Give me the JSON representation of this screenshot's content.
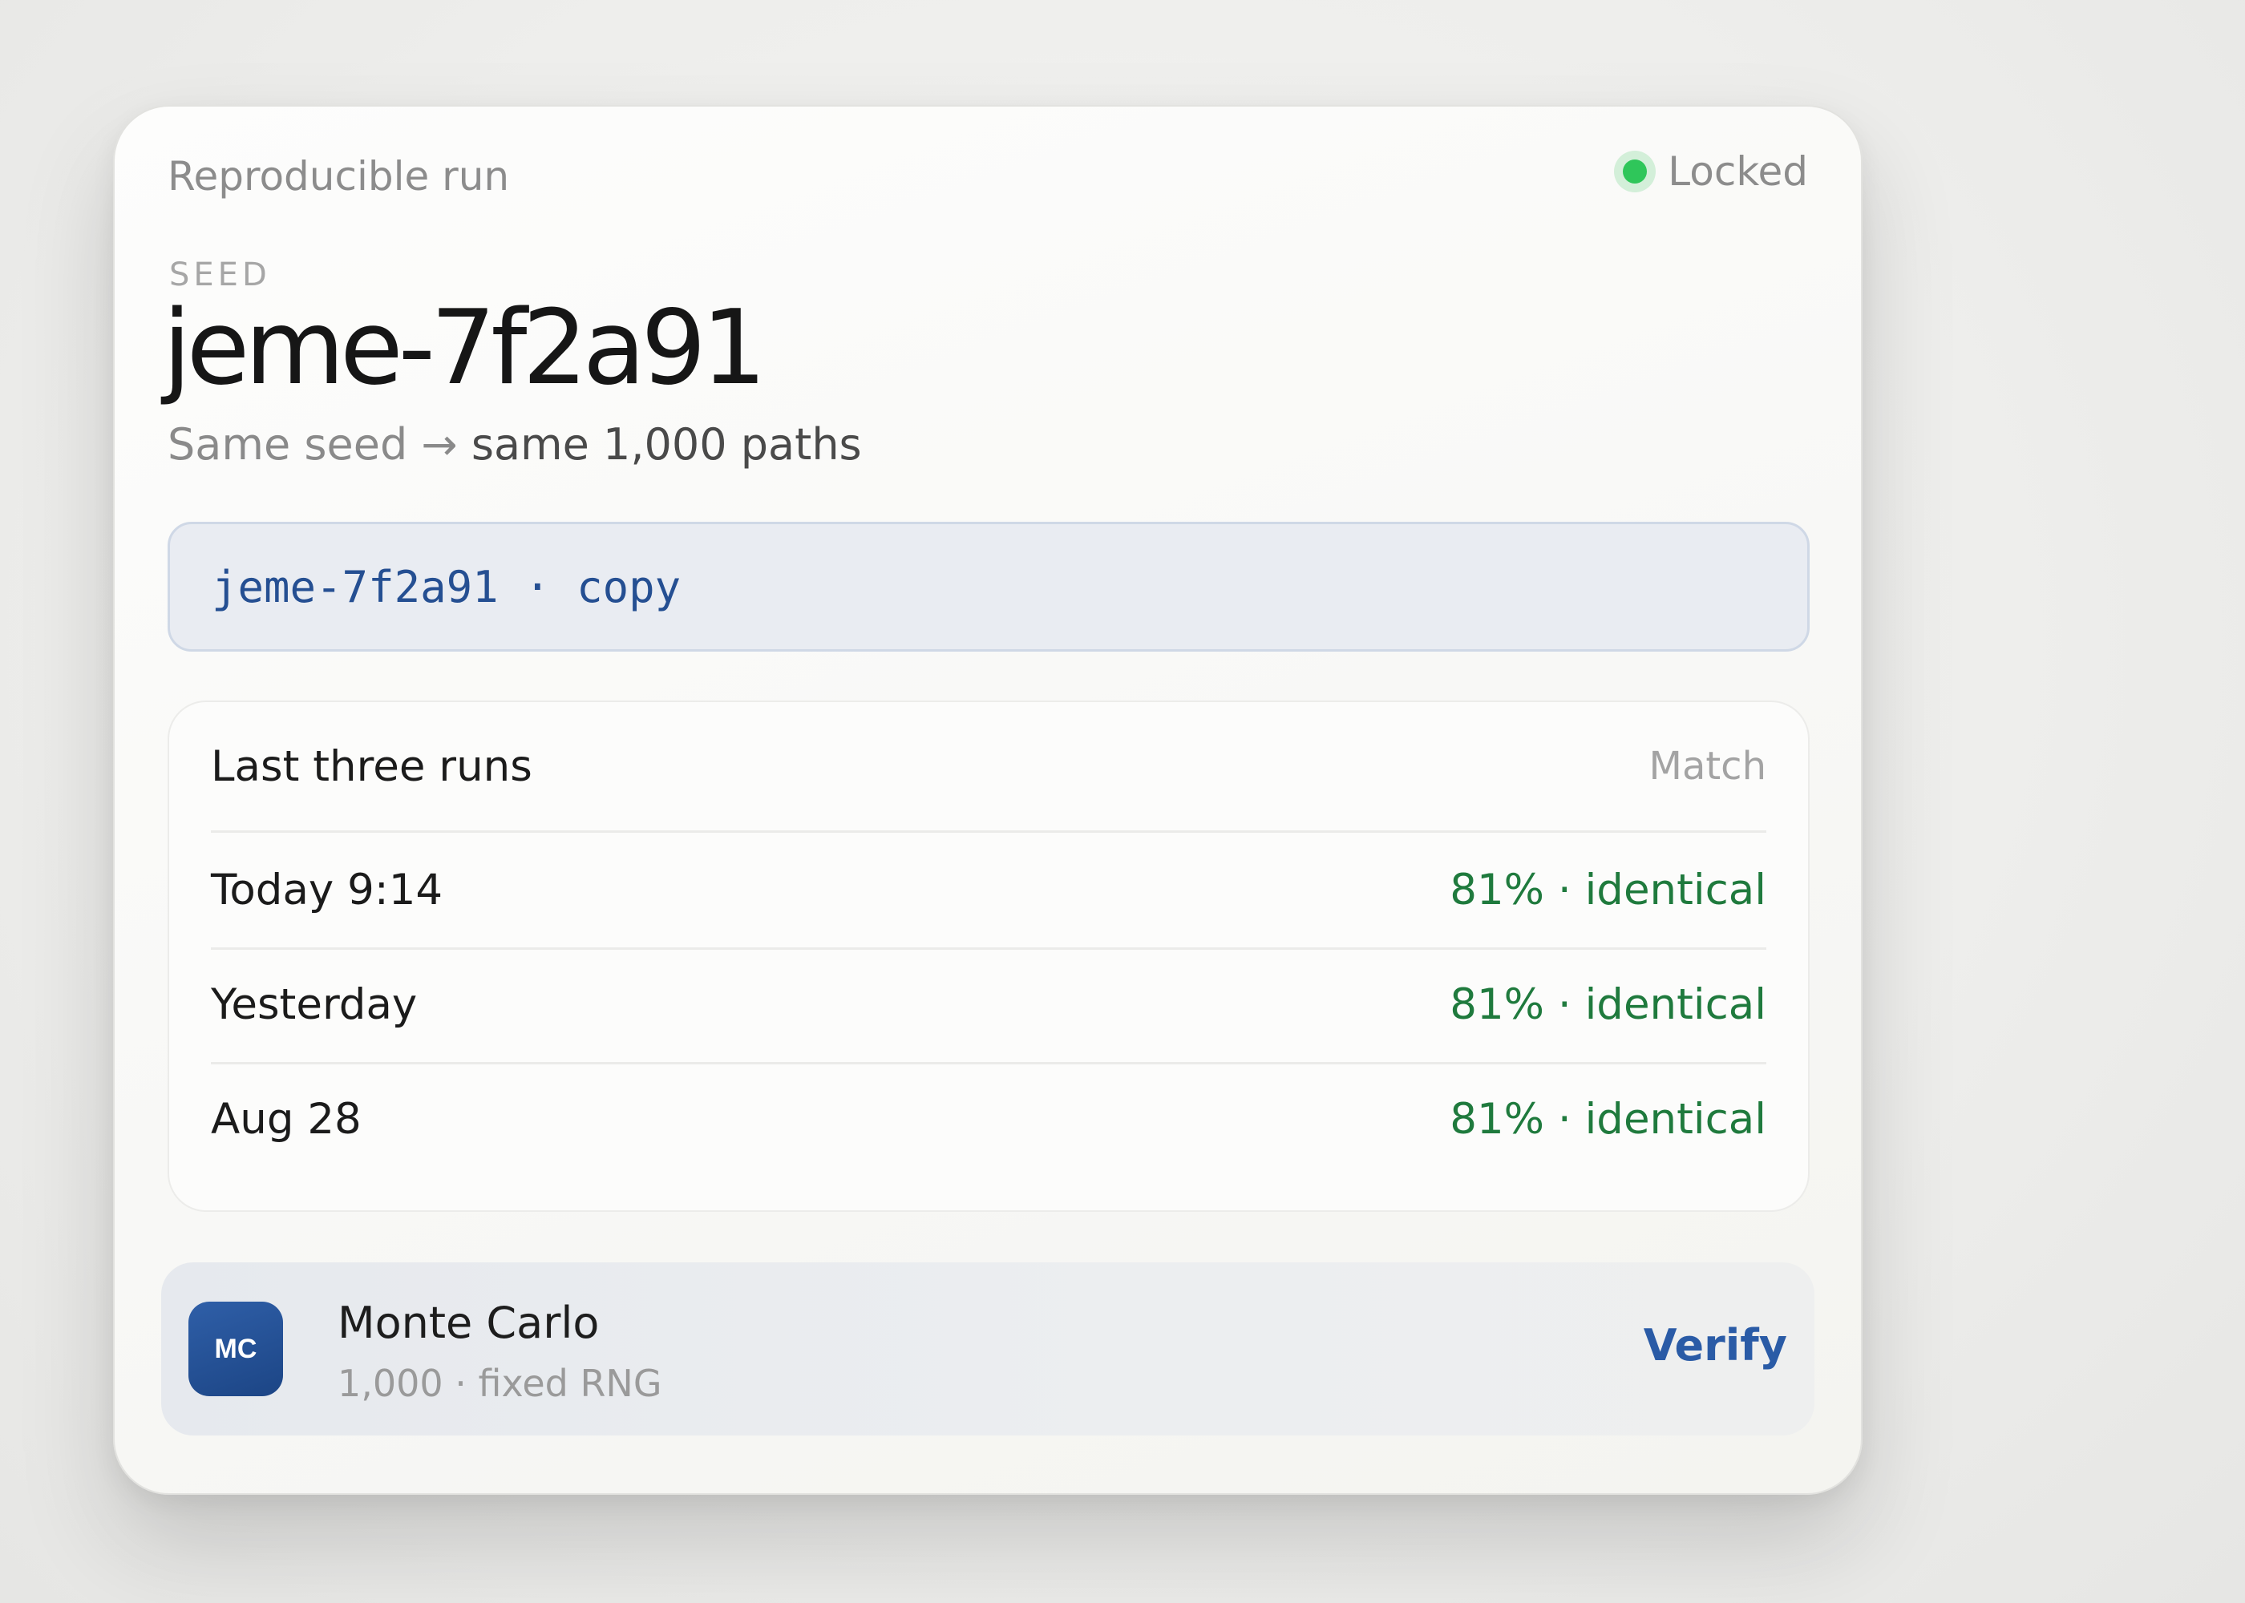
{
  "card": {
    "eyebrow": "Reproducible run",
    "status": {
      "label": "Locked",
      "color": "#2fc65a"
    }
  },
  "seed": {
    "caption": "SEED",
    "value": "jeme-7f2a91",
    "subtitle_muted": "Same seed →",
    "subtitle_strong": "same 1,000 paths",
    "copy_text": "jeme-7f2a91 · copy"
  },
  "runs": {
    "title": "Last three runs",
    "column_label": "Match",
    "rows": [
      {
        "date": "Today 9:14",
        "result": "81% · identical"
      },
      {
        "date": "Yesterday",
        "result": "81% · identical"
      },
      {
        "date": "Aug 28",
        "result": "81% · identical"
      }
    ]
  },
  "engine": {
    "badge": "MC",
    "name": "Monte Carlo",
    "meta": "1,000 · fixed RNG",
    "action_label": "Verify"
  },
  "colors": {
    "accent": "#2a5ba6",
    "success_text": "#1f7a3d",
    "status_dot": "#2fc65a"
  }
}
